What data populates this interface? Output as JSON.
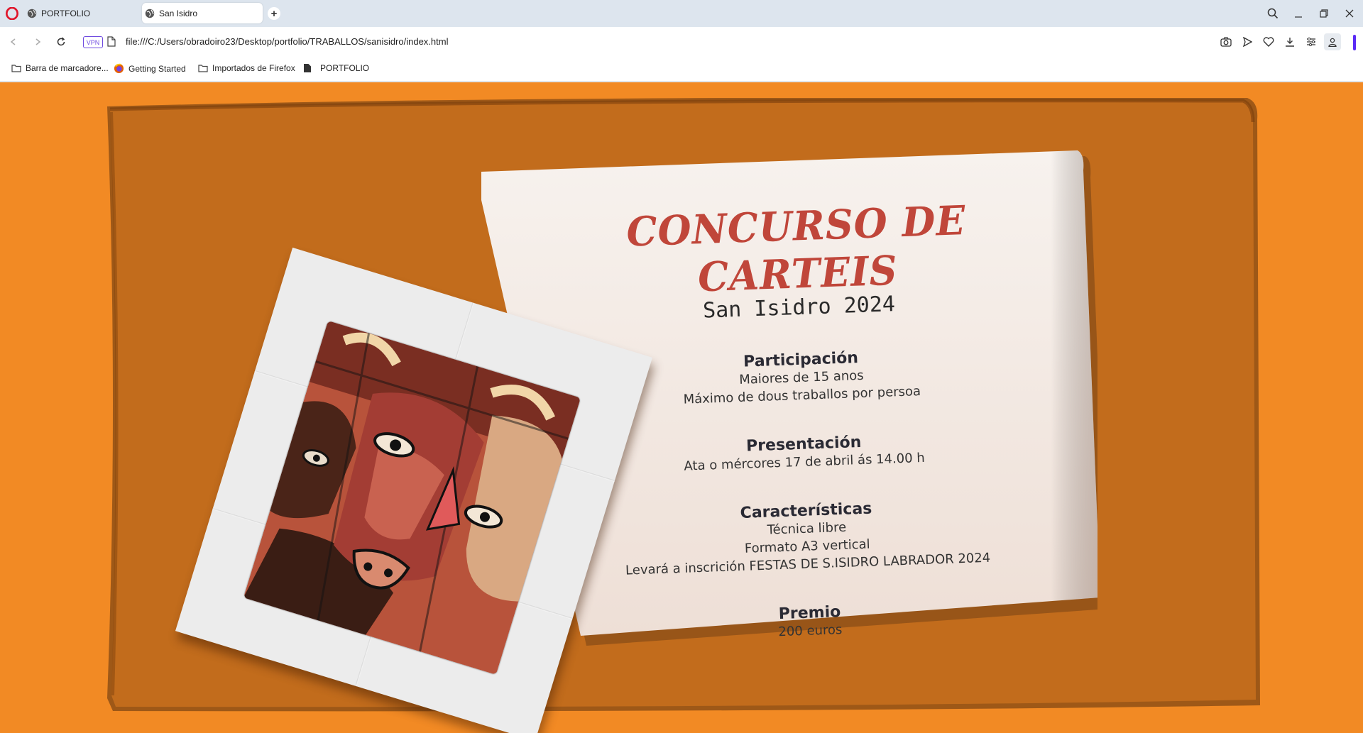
{
  "browser": {
    "tabs": [
      {
        "label": "PORTFOLIO",
        "active": false
      },
      {
        "label": "San Isidro",
        "active": true
      }
    ],
    "address": "file:///C:/Users/obradoiro23/Desktop/portfolio/TRABALLOS/sanisidro/index.html",
    "vpn_label": "VPN",
    "bookmarks": [
      {
        "label": "Barra de marcadore...",
        "icon": "folder-icon"
      },
      {
        "label": "Getting Started",
        "icon": "firefox-icon"
      },
      {
        "label": "Importados de Firefox",
        "icon": "folder-icon"
      },
      {
        "label": "PORTFOLIO",
        "icon": "document-icon"
      }
    ],
    "accent_color": "#5b2bf5"
  },
  "page": {
    "background_color": "#f28a24",
    "frame_color": "#c26c1c",
    "title": "CONCURSO DE CARTEIS",
    "subtitle": "San Isidro 2024",
    "title_color": "#c0463a",
    "sections": [
      {
        "title": "Participación",
        "lines": [
          "Maiores de 15 anos",
          "Máximo de dous traballos por persoa"
        ]
      },
      {
        "title": "Presentación",
        "lines": [
          "Ata o mércores 17 de abril ás 14.00 h"
        ]
      },
      {
        "title": "Características",
        "lines": [
          "Técnica libre",
          "Formato A3 vertical",
          "Levará a inscrición FESTAS DE S.ISIDRO LABRADOR 2024"
        ]
      },
      {
        "title": "Premio",
        "lines": [
          "200 euros"
        ]
      }
    ]
  }
}
